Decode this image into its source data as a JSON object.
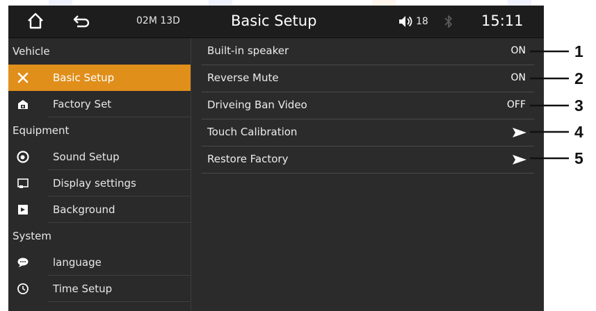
{
  "status_bar": {
    "home_icon": "home-icon",
    "back_icon": "back-arrow-icon",
    "distance": "02M 13D",
    "title": "Basic Setup",
    "volume_icon": "speaker-icon",
    "volume": "18",
    "bluetooth_icon": "bluetooth-icon",
    "time": "15:11"
  },
  "sidebar": {
    "sections": [
      {
        "label": "Vehicle"
      },
      {
        "label": "Equipment"
      },
      {
        "label": "System"
      }
    ],
    "items": [
      {
        "label": "Basic Setup",
        "icon": "tools-icon",
        "active": true
      },
      {
        "label": "Factory Set",
        "icon": "factory-icon"
      },
      {
        "label": "Sound Setup",
        "icon": "sound-icon"
      },
      {
        "label": "Display settings",
        "icon": "display-icon"
      },
      {
        "label": "Background",
        "icon": "background-icon"
      },
      {
        "label": "language",
        "icon": "speech-bubble-icon"
      },
      {
        "label": "Time Setup",
        "icon": "clock-icon"
      }
    ]
  },
  "settings": [
    {
      "label": "Built-in speaker",
      "value": "ON",
      "callout": "1"
    },
    {
      "label": "Reverse Mute",
      "value": "ON",
      "callout": "2"
    },
    {
      "label": "Driveing Ban Video",
      "value": "OFF",
      "callout": "3"
    },
    {
      "label": "Touch Calibration",
      "icon": "arrow-right-icon",
      "callout": "4"
    },
    {
      "label": "Restore Factory",
      "icon": "arrow-right-icon",
      "callout": "5"
    }
  ],
  "colors": {
    "accent": "#e08f1b",
    "background": "#2b2b2b",
    "status_bar": "#1d1d1d"
  }
}
